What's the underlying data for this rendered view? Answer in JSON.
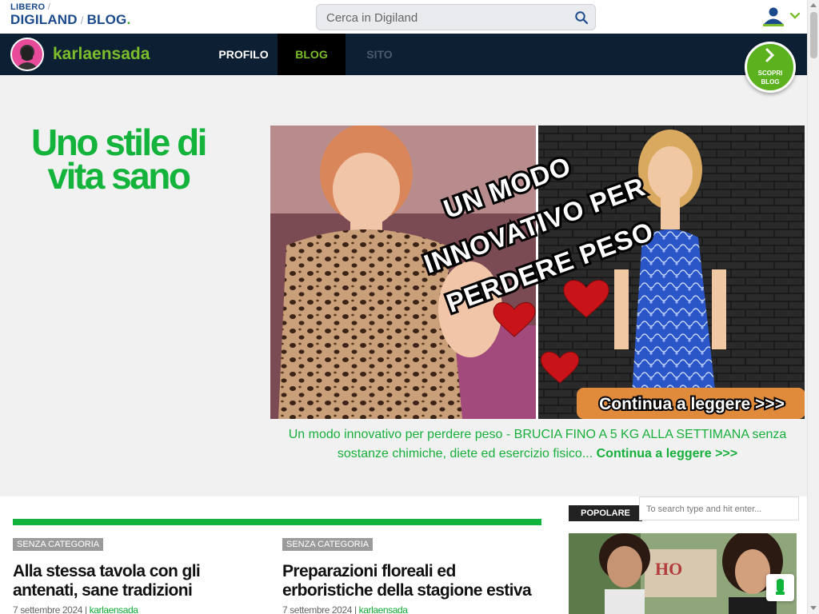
{
  "header": {
    "logo_line1": "LIBERO",
    "logo_separator1": "/",
    "logo_digiland": "DIGILAND",
    "logo_separator2": "/",
    "logo_blog": "BLOG",
    "logo_dot": ".",
    "search_placeholder": "Cerca in Digiland",
    "search_icon": "search-icon",
    "user_icon": "user-icon"
  },
  "blog_nav": {
    "blog_name": "karlaensada",
    "tabs": [
      {
        "label": "PROFILO",
        "active": false
      },
      {
        "label": "BLOG",
        "active": true
      },
      {
        "label": "SITO",
        "active": false
      }
    ],
    "discover_label_1": "SCOPRI",
    "discover_label_2": "BLOG",
    "accent_color": "#7bbd2a"
  },
  "hero": {
    "site_title": "Uno stile di vita sano",
    "banner_text_lines": [
      "UN MODO",
      "INNOVATIVO PER",
      "PERDERE PESO"
    ],
    "banner_cta": "Continua a leggere >>>",
    "caption": "Un modo innovativo per perdere peso - BRUCIA FINO A 5 KG ALLA SETTIMANA senza sostanze chimiche, diete ed esercizio fisico...",
    "caption_more": "Continua a leggere >>>"
  },
  "posts": [
    {
      "category": "SENZA CATEGORIA",
      "title": "Alla stessa tavola con gli antenati, sane tradizioni",
      "date": "7 settembre 2024",
      "separator": "|",
      "author": "karlaensada"
    },
    {
      "category": "SENZA CATEGORIA",
      "title": "Preparazioni floreali ed erboristiche della stagione estiva",
      "date": "7 settembre 2024",
      "separator": "|",
      "author": "karlaensada"
    }
  ],
  "sidebar": {
    "search_placeholder": "To search type and hit enter...",
    "popular_label": "POPOLARE",
    "sign_text": "HO"
  },
  "colors": {
    "brand_green": "#14b43c",
    "nav_bg": "#0d1f33",
    "logo_blue": "#1a4a8c"
  }
}
